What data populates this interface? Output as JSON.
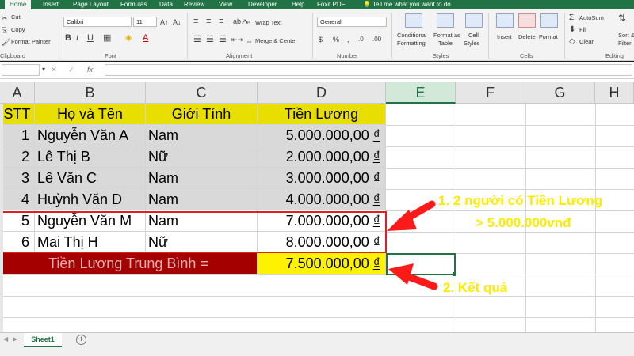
{
  "ribbon": {
    "tabs": [
      "Home",
      "Insert",
      "Page Layout",
      "Formulas",
      "Data",
      "Review",
      "View",
      "Developer",
      "Help",
      "Foxit PDF",
      "Tell me what you want to do"
    ],
    "clipboard": {
      "cut": "Cut",
      "copy": "Copy",
      "format_painter": "Format Painter",
      "group": "Clipboard"
    },
    "font": {
      "name": "Calibri",
      "size": "11",
      "group": "Font"
    },
    "alignment": {
      "wrap": "Wrap Text",
      "merge": "Merge & Center",
      "group": "Alignment"
    },
    "number": {
      "format": "General",
      "group": "Number"
    },
    "styles": {
      "conditional": "Conditional",
      "formatting": "Formatting",
      "format_as": "Format as",
      "table": "Table",
      "cell": "Cell",
      "cell_styles": "Styles",
      "group": "Styles"
    },
    "cells": {
      "insert": "Insert",
      "delete": "Delete",
      "format": "Format",
      "group": "Cells"
    },
    "editing": {
      "autosum": "AutoSum",
      "fill": "Fill",
      "clear": "Clear",
      "sort": "Sort &",
      "filter": "Filter",
      "group": "Editing"
    }
  },
  "formula_bar": {
    "fx": "fx",
    "cancel": "✕",
    "enter": "✓"
  },
  "columns": [
    "A",
    "B",
    "C",
    "D",
    "E",
    "F",
    "G",
    "H"
  ],
  "header_row": {
    "stt": "STT",
    "name": "Họ và Tên",
    "gender": "Giới Tính",
    "salary": "Tiền Lương"
  },
  "rows": [
    {
      "stt": "1",
      "name": "Nguyễn Văn A",
      "gender": "Nam",
      "salary": "5.000.000,00",
      "cur": "₫"
    },
    {
      "stt": "2",
      "name": "Lê Thị B",
      "gender": "Nữ",
      "salary": "2.000.000,00",
      "cur": "₫"
    },
    {
      "stt": "3",
      "name": "Lê Văn C",
      "gender": "Nam",
      "salary": "3.000.000,00",
      "cur": "₫"
    },
    {
      "stt": "4",
      "name": "Huỳnh Văn D",
      "gender": "Nam",
      "salary": "4.000.000,00",
      "cur": "₫"
    },
    {
      "stt": "5",
      "name": "Nguyễn Văn M",
      "gender": "Nam",
      "salary": "7.000.000,00",
      "cur": "₫"
    },
    {
      "stt": "6",
      "name": "Mai Thị H",
      "gender": "Nữ",
      "salary": "8.000.000,00",
      "cur": "₫"
    }
  ],
  "average_row": {
    "label": "Tiền Lương Trung Bình =",
    "value": "7.500.000,00",
    "cur": "₫"
  },
  "annotations": {
    "note1_line1": "1. 2 người có Tiền Lương",
    "note1_line2": "> 5.000.000vnđ",
    "note2": "2. Kết quả"
  },
  "sheet_tabs": {
    "active": "Sheet1",
    "add": "+"
  },
  "colors": {
    "accent": "#217346",
    "header_fill": "#e8de00",
    "average_fill": "#a50000",
    "result_fill": "#fff200",
    "annotation": "#ffeb00",
    "arrow": "#ff1a1a"
  }
}
